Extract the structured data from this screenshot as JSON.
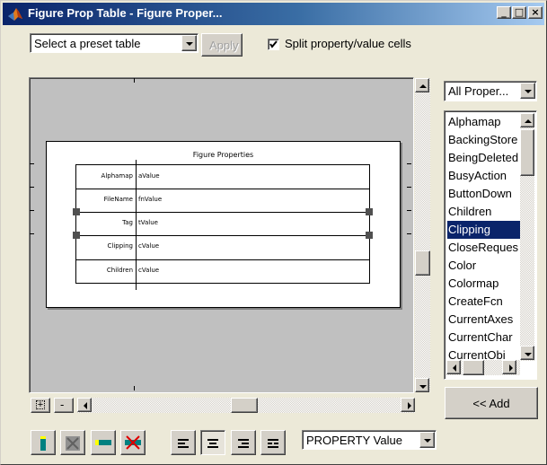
{
  "window": {
    "title": "Figure Prop Table - Figure Proper...",
    "minimize_glyph": "_",
    "maximize_glyph": "□",
    "close_glyph": "×"
  },
  "toolbar": {
    "preset_placeholder": "Select a preset table",
    "apply_label": "Apply",
    "split_label": "Split property/value cells",
    "split_checked": true
  },
  "preview": {
    "title": "Figure Properties",
    "rows": [
      {
        "property": "Alphamap",
        "value": "aValue"
      },
      {
        "property": "FileName",
        "value": "fnValue"
      },
      {
        "property": "Tag",
        "value": "tValue"
      },
      {
        "property": "Clipping",
        "value": "cValue"
      },
      {
        "property": "Children",
        "value": "cValue"
      }
    ]
  },
  "property_panel": {
    "filter": "All Proper...",
    "items": [
      "Alphamap",
      "BackingStore",
      "BeingDeleted",
      "BusyAction",
      "ButtonDown",
      "Children",
      "Clipping",
      "CloseReques",
      "Color",
      "Colormap",
      "CreateFcn",
      "CurrentAxes",
      "CurrentChar",
      "CurrentObj"
    ],
    "selected": "Clipping",
    "add_label": "<< Add"
  },
  "bottom": {
    "zoom_in_glyph": "+",
    "zoom_out_glyph": "-",
    "format_select": "PROPERTY Value"
  },
  "icons": {
    "app": "matlab-logo-icon",
    "insert_column": "insert-column-icon",
    "delete_column": "delete-column-icon",
    "insert_row": "insert-row-icon",
    "delete_row": "delete-row-icon",
    "align_left": "align-left-icon",
    "align_center": "align-center-icon",
    "align_right": "align-right-icon",
    "justify": "justify-icon"
  },
  "colors": {
    "title_gradient_start": "#0a246a",
    "title_gradient_end": "#a6caf0",
    "selection": "#0a246a",
    "canvas_background": "#c0c0c0",
    "icon_teal": "#008080"
  }
}
